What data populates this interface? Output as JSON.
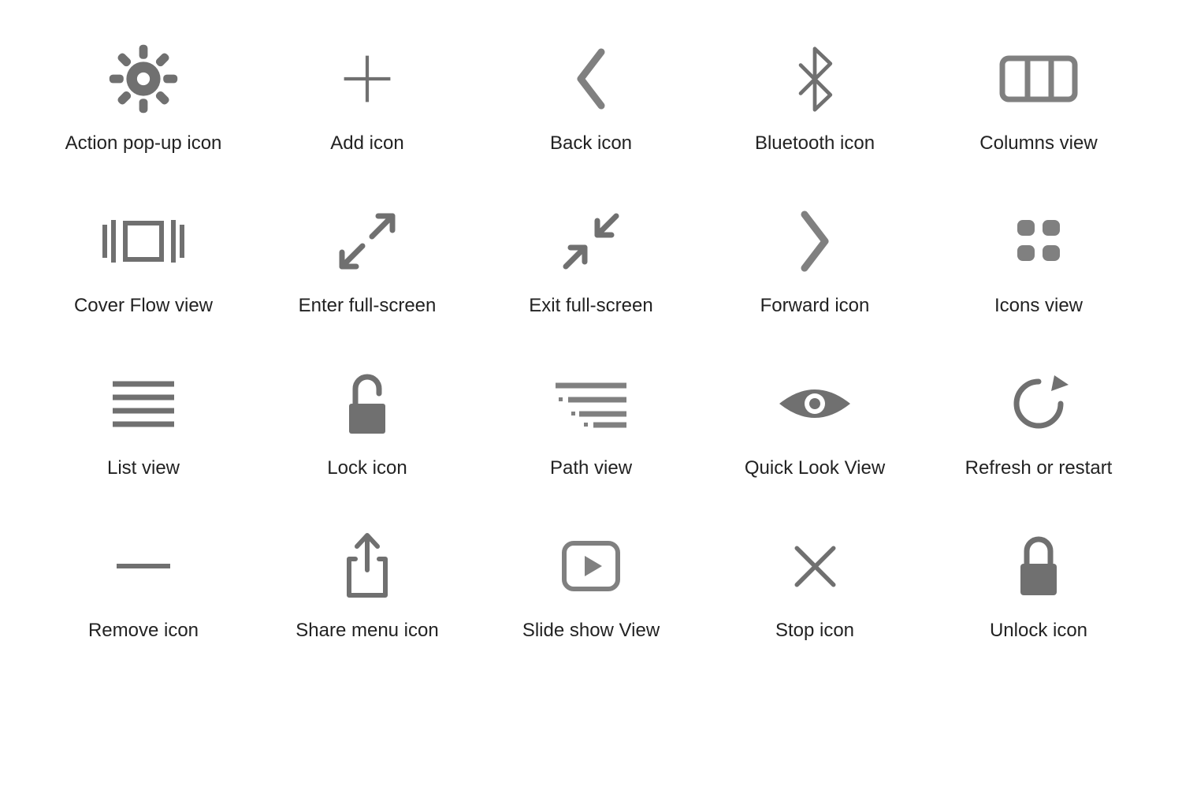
{
  "icons": [
    {
      "id": "gear-icon",
      "label": "Action pop-up icon"
    },
    {
      "id": "plus-icon",
      "label": "Add icon"
    },
    {
      "id": "chevron-left-icon",
      "label": "Back icon"
    },
    {
      "id": "bluetooth-icon",
      "label": "Bluetooth icon"
    },
    {
      "id": "columns-view-icon",
      "label": "Columns view"
    },
    {
      "id": "cover-flow-icon",
      "label": "Cover Flow view"
    },
    {
      "id": "enter-fullscreen-icon",
      "label": "Enter full-screen"
    },
    {
      "id": "exit-fullscreen-icon",
      "label": "Exit full-screen"
    },
    {
      "id": "chevron-right-icon",
      "label": "Forward icon"
    },
    {
      "id": "icons-view-icon",
      "label": "Icons view"
    },
    {
      "id": "list-view-icon",
      "label": "List view"
    },
    {
      "id": "unlocked-padlock-icon",
      "label": "Lock icon"
    },
    {
      "id": "path-view-icon",
      "label": "Path view"
    },
    {
      "id": "eye-icon",
      "label": "Quick Look View"
    },
    {
      "id": "refresh-icon",
      "label": "Refresh or restart"
    },
    {
      "id": "minus-icon",
      "label": "Remove icon"
    },
    {
      "id": "share-icon",
      "label": "Share menu icon"
    },
    {
      "id": "slideshow-icon",
      "label": "Slide show View"
    },
    {
      "id": "x-icon",
      "label": "Stop icon"
    },
    {
      "id": "locked-padlock-icon",
      "label": "Unlock icon"
    }
  ],
  "colors": {
    "icon": "#707070"
  }
}
